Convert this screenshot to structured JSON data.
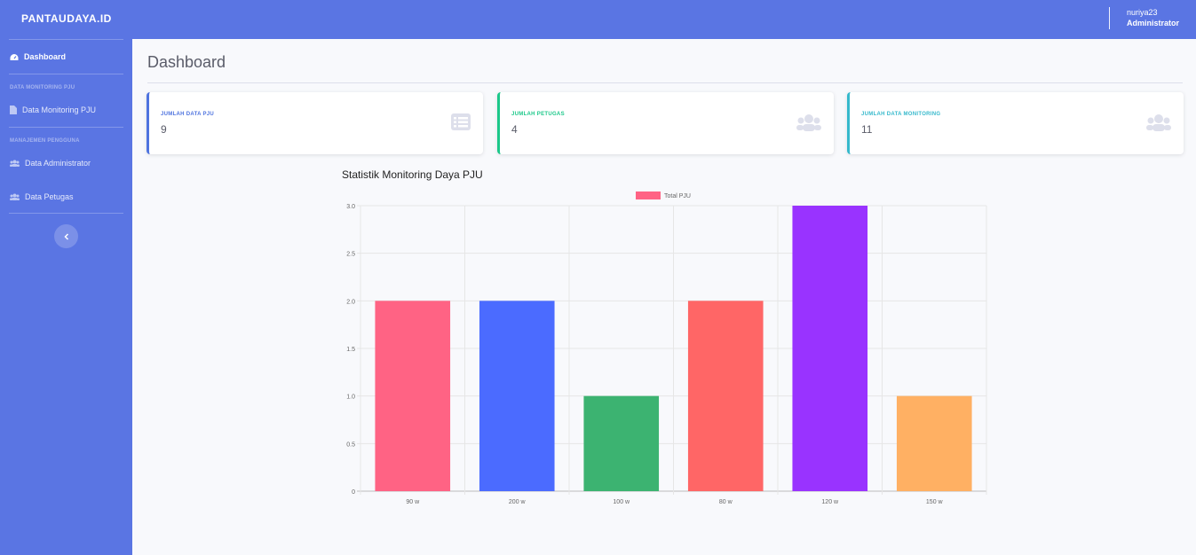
{
  "brand": "PANTAUDAYA.ID",
  "user": {
    "name": "nuriya23",
    "role": "Administrator"
  },
  "sidebar": {
    "dashboard": "Dashboard",
    "heading_monitoring": "DATA MONITORING PJU",
    "monitoring": "Data Monitoring PJU",
    "heading_users": "MANAJEMEN PENGGUNA",
    "administrator": "Data Administrator",
    "petugas": "Data Petugas"
  },
  "page_title": "Dashboard",
  "cards": [
    {
      "label": "JUMLAH DATA PJU",
      "value": "9",
      "color": "#4e73df",
      "icon": "list-icon"
    },
    {
      "label": "JUMLAH PETUGAS",
      "value": "4",
      "color": "#1cc88a",
      "icon": "users-icon"
    },
    {
      "label": "JUMLAH DATA MONITORING",
      "value": "11",
      "color": "#36b9cc",
      "icon": "users-icon"
    }
  ],
  "chart_title": "Statistik Monitoring Daya PJU",
  "chart_data": {
    "type": "bar",
    "categories": [
      "90 w",
      "200 w",
      "100 w",
      "80 w",
      "120 w",
      "150 w"
    ],
    "series": [
      {
        "name": "Total PJU",
        "values": [
          2,
          2,
          1,
          2,
          3,
          1
        ]
      }
    ],
    "colors": [
      "#ff6384",
      "#4b6bff",
      "#3cb371",
      "#ff6666",
      "#9933ff",
      "#ffb063"
    ],
    "legend_color": "#ff6384",
    "ylim": [
      0,
      3
    ],
    "yticks": [
      "0",
      "0.5",
      "1.0",
      "1.5",
      "2.0",
      "2.5",
      "3.0"
    ],
    "ytick_values": [
      0,
      0.5,
      1,
      1.5,
      2,
      2.5,
      3
    ],
    "grid": true,
    "legend_position": "top"
  }
}
